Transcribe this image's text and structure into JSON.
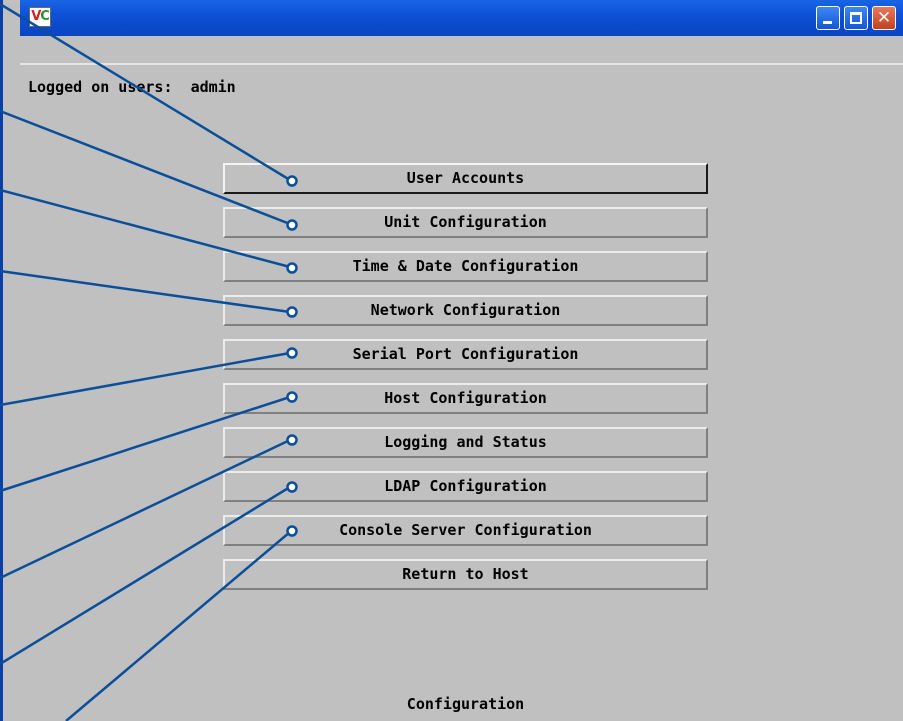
{
  "window": {
    "icon_text_v": "V",
    "icon_text_c": "C",
    "minimize_icon": "minimize-icon",
    "maximize_icon": "maximize-icon",
    "close_glyph": "✕"
  },
  "header": {
    "logged_on_label": "Logged on users:",
    "logged_on_user": "admin"
  },
  "menu": {
    "items": [
      {
        "label": "User Accounts"
      },
      {
        "label": "Unit Configuration"
      },
      {
        "label": "Time & Date Configuration"
      },
      {
        "label": "Network Configuration"
      },
      {
        "label": "Serial Port Configuration"
      },
      {
        "label": "Host Configuration"
      },
      {
        "label": "Logging and Status"
      },
      {
        "label": "LDAP Configuration"
      },
      {
        "label": "Console Server Configuration"
      },
      {
        "label": "Return to Host"
      }
    ]
  },
  "footer": {
    "status": "Configuration"
  },
  "colors": {
    "callout": "#0b4f9a",
    "titlebar": "#0b50d6",
    "background": "#c0c0c0"
  }
}
